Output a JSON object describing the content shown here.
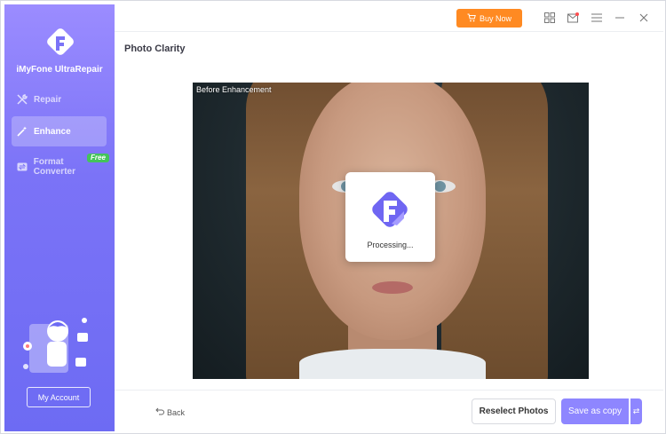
{
  "app": {
    "name": "iMyFone UltraRepair"
  },
  "sidebar": {
    "items": [
      {
        "label": "Repair",
        "icon": "tools-icon",
        "active": false
      },
      {
        "label": "Enhance",
        "icon": "magic-wand-icon",
        "active": true
      },
      {
        "label": "Format Converter",
        "icon": "convert-icon",
        "active": false,
        "badge": "Free"
      }
    ],
    "account_label": "My Account"
  },
  "topbar": {
    "buy_label": "Buy Now",
    "icons": [
      "grid-icon",
      "mail-icon",
      "menu-icon",
      "minimize-icon",
      "close-icon"
    ]
  },
  "main": {
    "title": "Photo Clarity",
    "photo_label": "Before Enhancement",
    "processing_text": "Processing..."
  },
  "footer": {
    "back_label": "Back",
    "reselect_label": "Reselect Photos",
    "save_label": "Save as copy"
  },
  "colors": {
    "accent": "#7b73f7",
    "buy": "#ff8a22",
    "save": "#8e86ff",
    "free_badge": "#44c45a"
  }
}
